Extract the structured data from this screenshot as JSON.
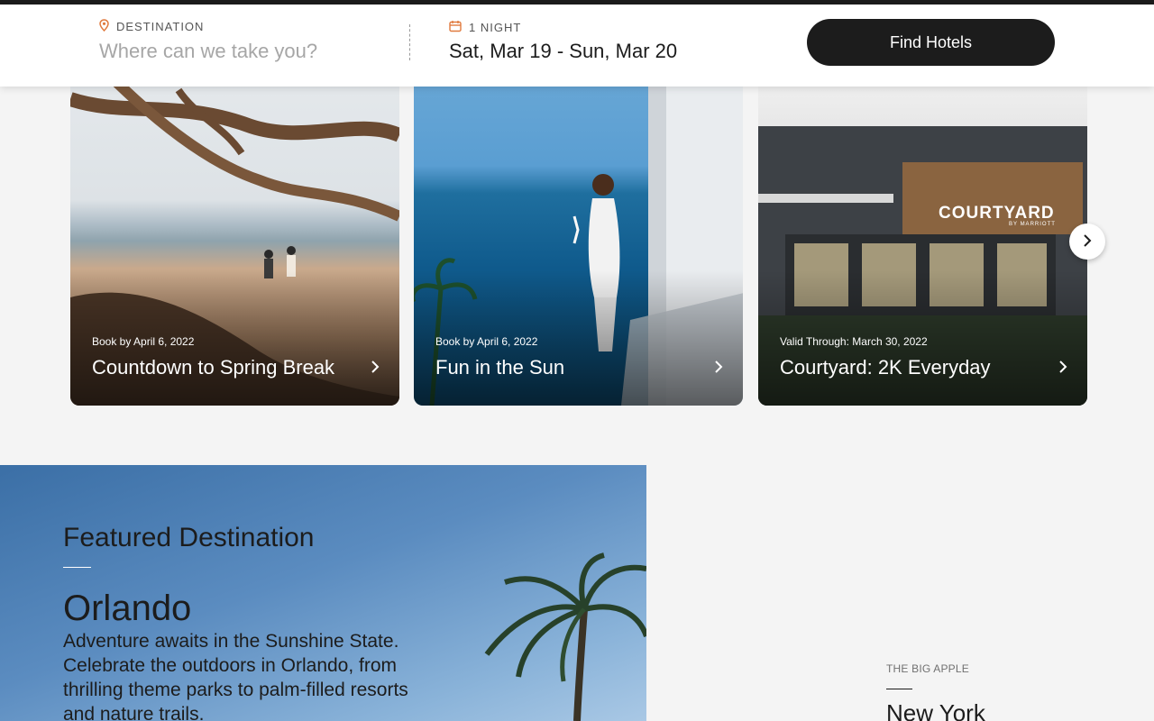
{
  "search": {
    "destination_label": "DESTINATION",
    "destination_placeholder": "Where can we take you?",
    "nights_label": "1 NIGHT",
    "dates_value": "Sat, Mar 19 - Sun, Mar 20",
    "find_button": "Find Hotels"
  },
  "offers": [
    {
      "subtitle": "Book by April 6, 2022",
      "title": "Countdown to Spring Break"
    },
    {
      "subtitle": "Book by April 6, 2022",
      "title": "Fun in the Sun"
    },
    {
      "subtitle": "Valid Through: March 30, 2022",
      "title": "Courtyard: 2K Everyday",
      "sign_text": "COURTYARD",
      "sign_subtext": "BY MARRIOTT"
    }
  ],
  "featured": {
    "heading": "Featured Destination",
    "city": "Orlando",
    "description": "Adventure awaits in the Sunshine State. Celebrate the outdoors in Orlando, from thrilling theme parks to palm-filled resorts and nature trails."
  },
  "new_york": {
    "eyebrow": "THE BIG APPLE",
    "title": "New York"
  },
  "colors": {
    "accent": "#e07a3e",
    "dark": "#1c1c1c"
  },
  "icons": {
    "destination": "location-pin-icon",
    "dates": "calendar-icon",
    "card_arrow": "chevron-right-icon",
    "carousel_next": "chevron-right-icon"
  }
}
